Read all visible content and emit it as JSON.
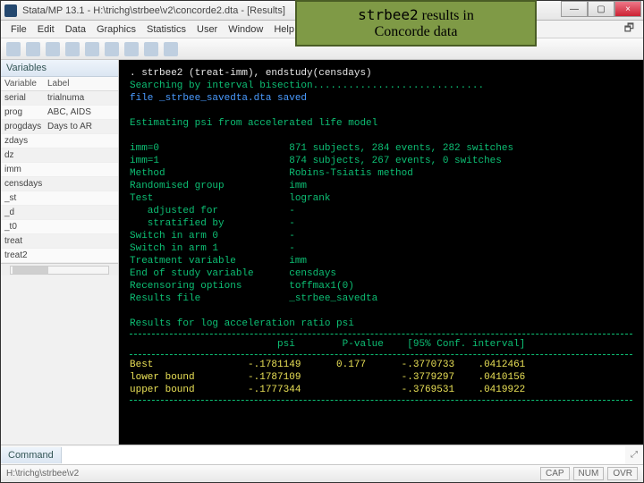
{
  "window": {
    "title": "Stata/MP 13.1 - H:\\trichg\\strbee\\v2\\concorde2.dta - [Results]"
  },
  "overlay": {
    "line1_code": "strbee2",
    "line1_rest": " results in",
    "line2": "Concorde data"
  },
  "menu": [
    "File",
    "Edit",
    "Data",
    "Graphics",
    "Statistics",
    "User",
    "Window",
    "Help"
  ],
  "restore_glyph": "🗗",
  "win_controls": {
    "min": "—",
    "max": "▢",
    "close": "×"
  },
  "sidebar": {
    "panel_title": "Variables",
    "head_var": "Variable",
    "head_lbl": "Label",
    "rows": [
      {
        "v": "serial",
        "l": "trialnuma"
      },
      {
        "v": "prog",
        "l": "ABC, AIDS"
      },
      {
        "v": "progdays",
        "l": "Days to AR"
      },
      {
        "v": "zdays",
        "l": ""
      },
      {
        "v": "dz",
        "l": ""
      },
      {
        "v": "imm",
        "l": ""
      },
      {
        "v": "censdays",
        "l": ""
      },
      {
        "v": "_st",
        "l": ""
      },
      {
        "v": "_d",
        "l": ""
      },
      {
        "v": "_t0",
        "l": ""
      },
      {
        "v": "treat",
        "l": ""
      },
      {
        "v": "treat2",
        "l": ""
      }
    ]
  },
  "results": {
    "cmdline": ". strbee2 (treat-imm), endstudy(censdays)",
    "search": "Searching by interval bisection.............................",
    "saved": "file _strbee_savedta.dta saved",
    "heading": "Estimating psi from accelerated life model",
    "imm0": "imm=0                      871 subjects, 284 events, 282 switches",
    "imm1": "imm=1                      874 subjects, 267 events, 0 switches",
    "method": "Method                     Robins-Tsiatis method",
    "randgrp": "Randomised group           imm",
    "test": "Test                       logrank",
    "adjfor": "   adjusted for            -",
    "stratby": "   stratified by           -",
    "sw0": "Switch in arm 0            -",
    "sw1": "Switch in arm 1            -",
    "treatvar": "Treatment variable         imm",
    "endstudy": "End of study variable      censdays",
    "recensor": "Recensoring options        toffmax1(0)",
    "resfile": "Results file               _strbee_savedta",
    "tablehdr": "Results for log acceleration ratio psi",
    "cols": "                         psi        P-value    [95% Conf. interval]",
    "best": "Best                -.1781149      0.177      -.3770733    .0412461",
    "lower": "lower bound         -.1787109                 -.3779297    .0410156",
    "upper": "upper bound         -.1777344                 -.3769531    .0419922"
  },
  "command": {
    "label": "Command",
    "placeholder": "",
    "pin": "⤢"
  },
  "status": {
    "path": "H:\\trichg\\strbee\\v2",
    "indicators": [
      "CAP",
      "NUM",
      "OVR"
    ]
  },
  "chart_data": {
    "type": "table",
    "title": "Results for log acceleration ratio psi",
    "columns": [
      "",
      "psi",
      "P-value",
      "95% CI lower",
      "95% CI upper"
    ],
    "rows": [
      [
        "Best",
        -0.1781149,
        0.177,
        -0.3770733,
        0.0412461
      ],
      [
        "lower bound",
        -0.1787109,
        null,
        -0.3779297,
        0.0410156
      ],
      [
        "upper bound",
        -0.1777344,
        null,
        -0.3769531,
        0.0419922
      ]
    ],
    "model_summary": {
      "imm=0": {
        "subjects": 871,
        "events": 284,
        "switches": 282
      },
      "imm=1": {
        "subjects": 874,
        "events": 267,
        "switches": 0
      },
      "method": "Robins-Tsiatis method",
      "randomised_group": "imm",
      "test": "logrank",
      "treatment_variable": "imm",
      "end_of_study_variable": "censdays",
      "recensoring_options": "toffmax1(0)",
      "results_file": "_strbee_savedta"
    }
  }
}
